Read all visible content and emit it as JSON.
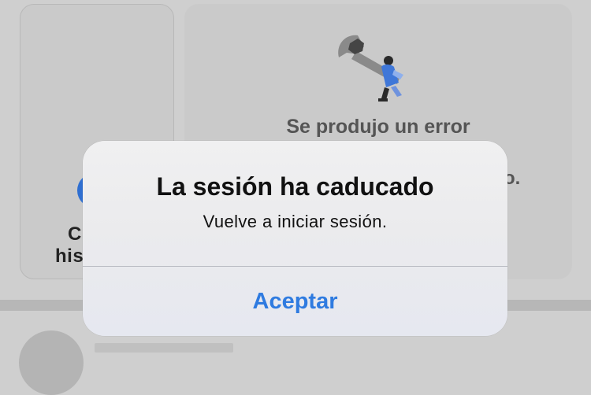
{
  "background": {
    "left_card": {
      "line1": "C",
      "line2": "his"
    },
    "right_card": {
      "error_icon": "wrench-with-worker-icon",
      "error_title": "Se produjo un error",
      "error_line_tail": "o."
    }
  },
  "alert": {
    "title": "La sesión ha caducado",
    "message": "Vuelve a iniciar sesión.",
    "button_label": "Aceptar"
  },
  "colors": {
    "accent": "#2f7be0",
    "left_card_circle": "#2f6fd1",
    "backdrop": "#cfcfcf"
  }
}
